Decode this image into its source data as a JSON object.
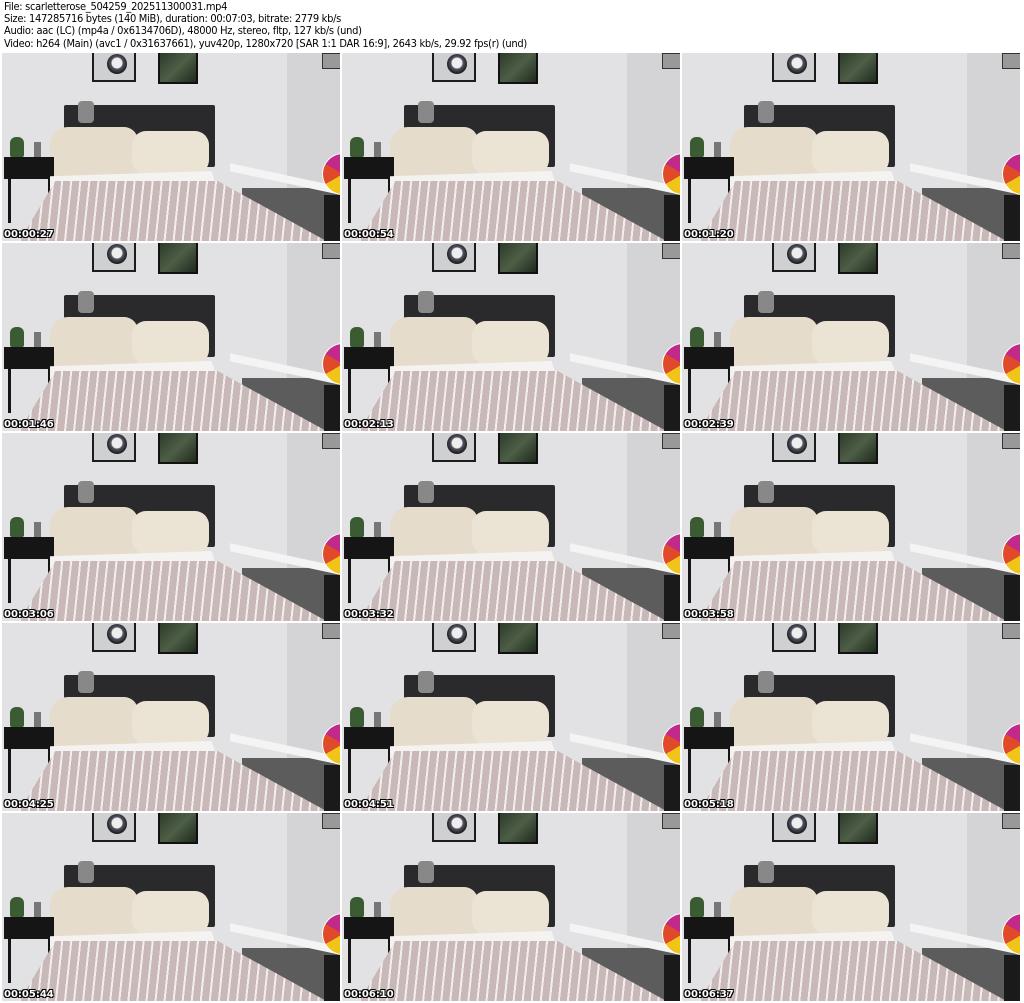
{
  "header": {
    "file": "File: scarletterose_504259_202511300031.mp4",
    "size": "Size: 147285716 bytes (140 MiB), duration: 00:07:03, bitrate: 2779 kb/s",
    "audio": "Audio: aac (LC) (mp4a / 0x6134706D), 48000 Hz, stereo, fltp, 127 kb/s (und)",
    "video": "Video: h264 (Main) (avc1 / 0x31637661), yuv420p, 1280x720 [SAR 1:1 DAR 16:9], 2643 kb/s, 29.92 fps(r) (und)"
  },
  "thumbnails": [
    {
      "timestamp": "00:00:27"
    },
    {
      "timestamp": "00:00:54"
    },
    {
      "timestamp": "00:01:20"
    },
    {
      "timestamp": "00:01:46"
    },
    {
      "timestamp": "00:02:13"
    },
    {
      "timestamp": "00:02:39"
    },
    {
      "timestamp": "00:03:06"
    },
    {
      "timestamp": "00:03:32"
    },
    {
      "timestamp": "00:03:58"
    },
    {
      "timestamp": "00:04:25"
    },
    {
      "timestamp": "00:04:51"
    },
    {
      "timestamp": "00:05:18"
    },
    {
      "timestamp": "00:05:44"
    },
    {
      "timestamp": "00:06:10"
    },
    {
      "timestamp": "00:06:37"
    }
  ]
}
